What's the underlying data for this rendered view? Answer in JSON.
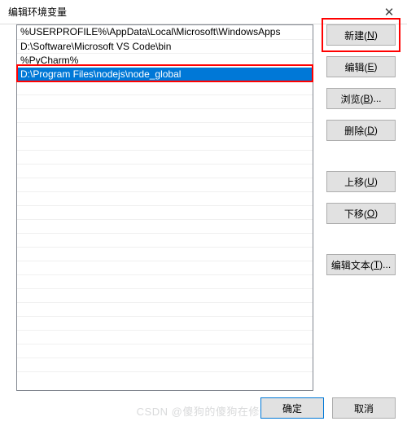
{
  "title": "编辑环境变量",
  "close_glyph": "✕",
  "list": {
    "items": [
      {
        "text": "%USERPROFILE%\\AppData\\Local\\Microsoft\\WindowsApps",
        "selected": false
      },
      {
        "text": "D:\\Software\\Microsoft VS Code\\bin",
        "selected": false
      },
      {
        "text": "%PyCharm%",
        "selected": false
      },
      {
        "text": "D:\\Program Files\\nodejs\\node_global",
        "selected": true
      }
    ]
  },
  "buttons": {
    "new_label": "新建(",
    "new_key": "N",
    "new_close": ")",
    "edit_label": "编辑(",
    "edit_key": "E",
    "edit_close": ")",
    "browse_label": "浏览(",
    "browse_key": "B",
    "browse_close": ")...",
    "delete_label": "删除(",
    "delete_key": "D",
    "delete_close": ")",
    "moveup_label": "上移(",
    "moveup_key": "U",
    "moveup_close": ")",
    "movedown_label": "下移(",
    "movedown_key": "O",
    "movedown_close": ")",
    "edittext_label": "编辑文本(",
    "edittext_key": "T",
    "edittext_close": ")..."
  },
  "footer": {
    "ok": "确定",
    "cancel": "取消"
  },
  "watermark": "CSDN @傻狗的傻狗在修沟"
}
